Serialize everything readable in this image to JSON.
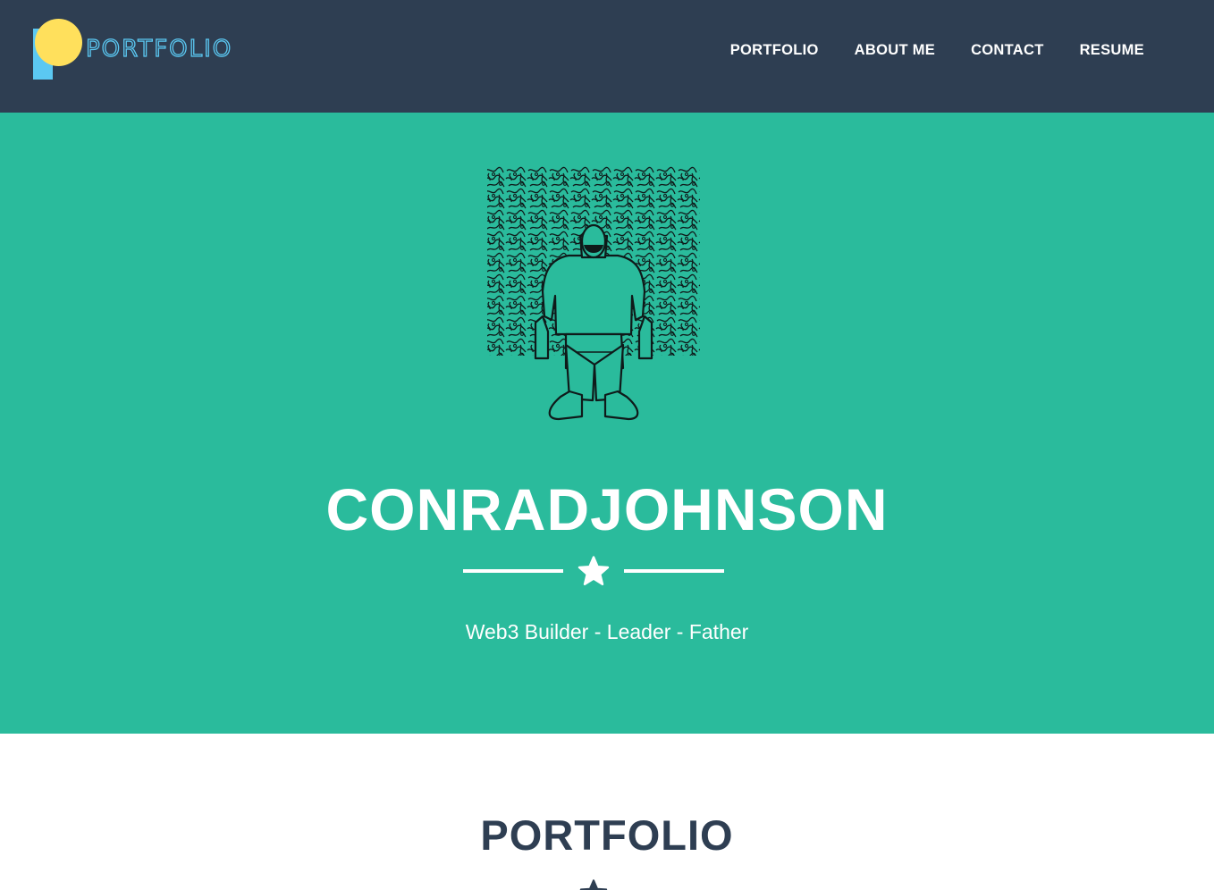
{
  "navbar": {
    "brand_text": "PORTFOLIO",
    "links": [
      {
        "label": "PORTFOLIO"
      },
      {
        "label": "ABOUT ME"
      },
      {
        "label": "CONTACT"
      },
      {
        "label": "RESUME"
      }
    ]
  },
  "masthead": {
    "avatar_icon": "seated-man-pattern-illustration",
    "name": "CONRADJOHNSON",
    "divider_icon": "star-icon",
    "tagline": "Web3 Builder - Leader - Father"
  },
  "portfolio_section": {
    "title": "PORTFOLIO",
    "divider_icon": "star-icon"
  },
  "colors": {
    "navbar_bg": "#2e3e52",
    "masthead_bg": "#2abb9c",
    "logo_yellow": "#ffe05c",
    "logo_blue": "#5bc8f2",
    "text_light": "#ffffff",
    "text_dark": "#2e3e52"
  }
}
